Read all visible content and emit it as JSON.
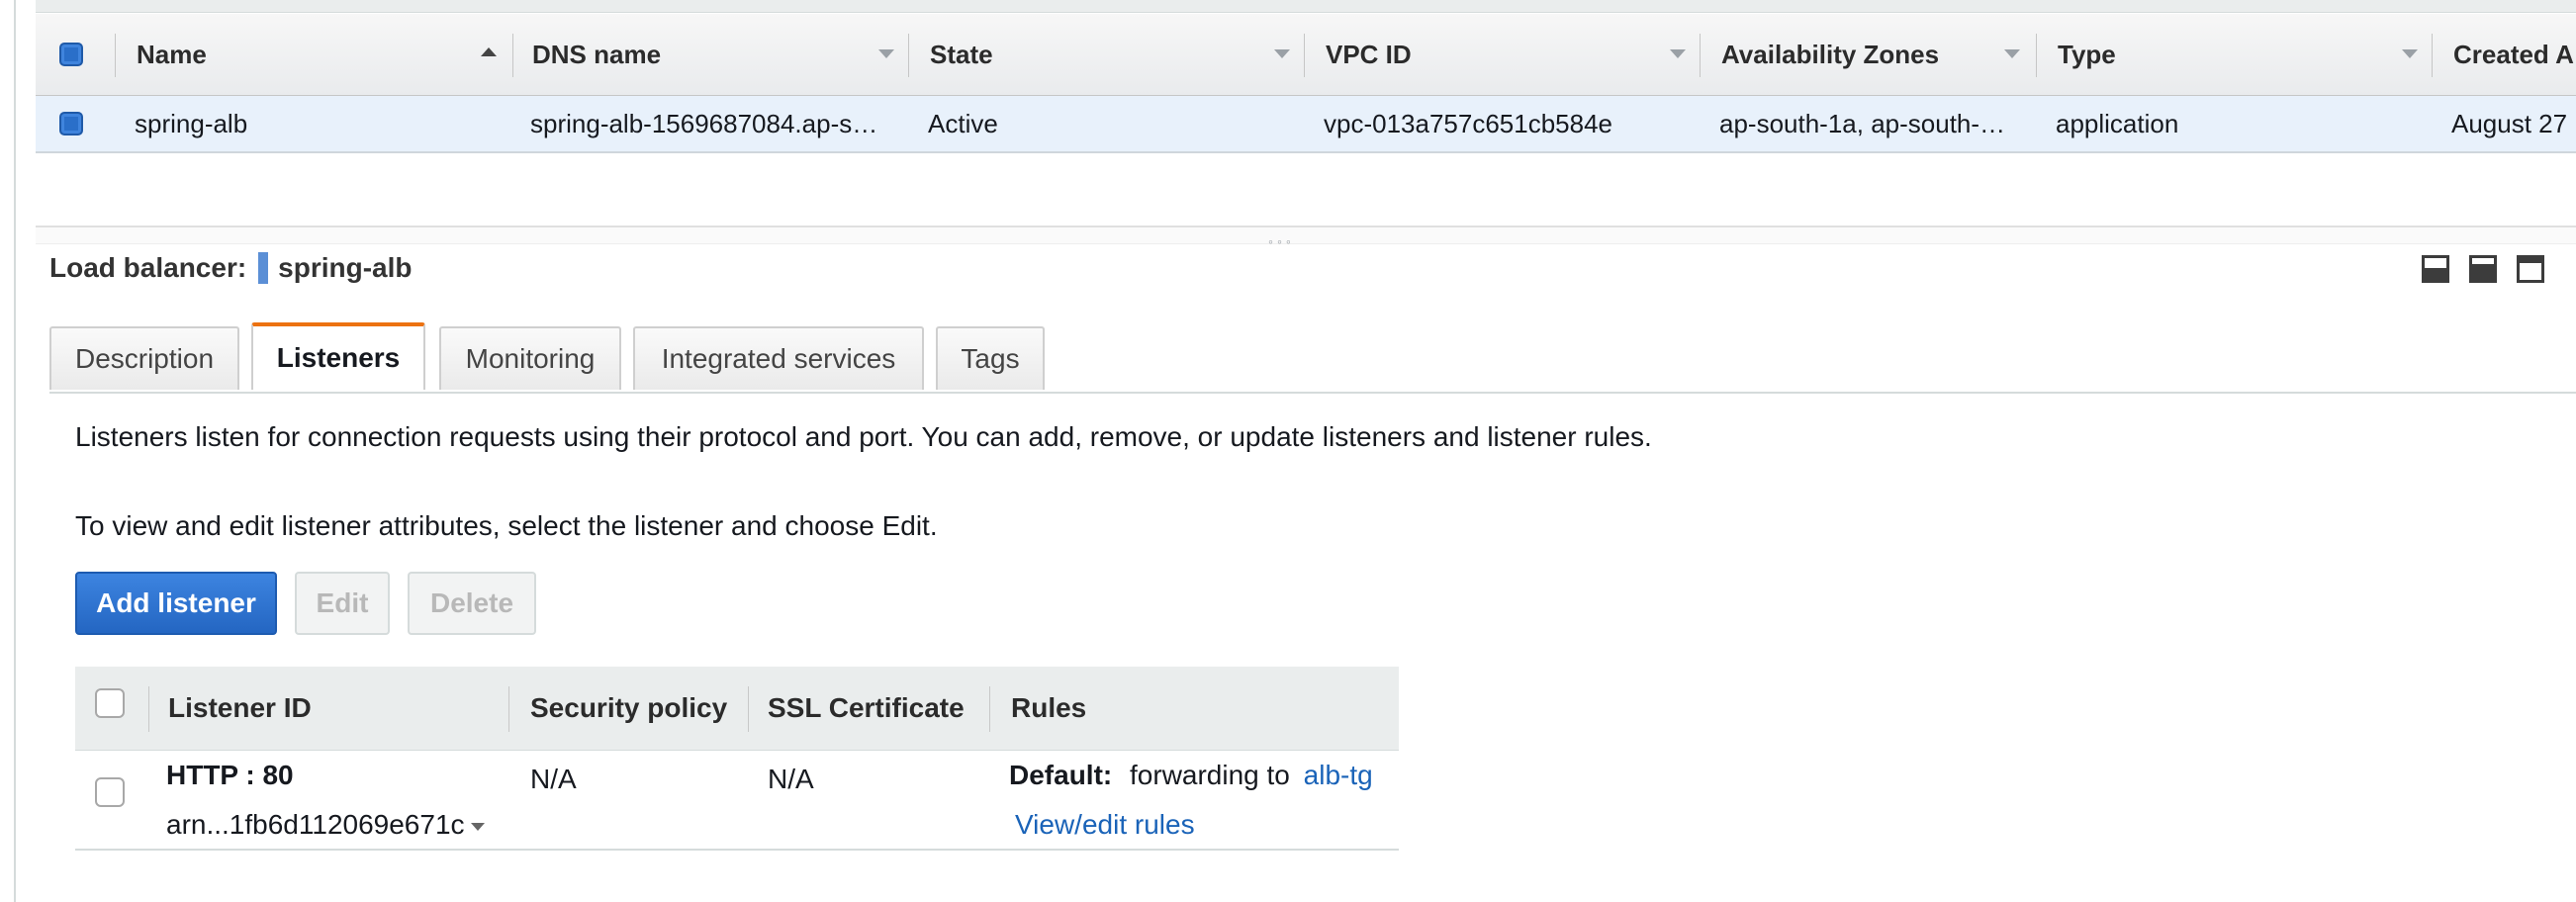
{
  "grid": {
    "columns": [
      {
        "label": "Name"
      },
      {
        "label": "DNS name"
      },
      {
        "label": "State"
      },
      {
        "label": "VPC ID"
      },
      {
        "label": "Availability Zones"
      },
      {
        "label": "Type"
      },
      {
        "label": "Created A"
      }
    ],
    "rows": [
      {
        "selected": true,
        "name": "spring-alb",
        "dns_name": "spring-alb-1569687084.ap-s…",
        "state": "Active",
        "vpc_id": "vpc-013a757c651cb584e",
        "availability_zones": "ap-south-1a, ap-south-…",
        "type": "application",
        "created": "August 27"
      }
    ]
  },
  "details": {
    "label": "Load balancer:",
    "name": "spring-alb",
    "tabs": [
      {
        "label": "Description",
        "active": false
      },
      {
        "label": "Listeners",
        "active": true
      },
      {
        "label": "Monitoring",
        "active": false
      },
      {
        "label": "Integrated services",
        "active": false
      },
      {
        "label": "Tags",
        "active": false
      }
    ]
  },
  "listeners": {
    "intro": "Listeners listen for connection requests using their protocol and port. You can add, remove, or update listeners and listener rules.",
    "instructions": "To view and edit listener attributes, select the listener and choose Edit.",
    "buttons": {
      "add": "Add listener",
      "edit": "Edit",
      "delete": "Delete"
    },
    "table": {
      "headers": {
        "listener_id": "Listener ID",
        "security_policy": "Security policy",
        "ssl_certificate": "SSL Certificate",
        "rules": "Rules"
      },
      "rows": [
        {
          "protocol_port": "HTTP : 80",
          "arn": "arn...1fb6d112069e671c",
          "security_policy": "N/A",
          "ssl_certificate": "N/A",
          "default_label": "Default:",
          "default_action": "forwarding to",
          "target_group": "alb-tg",
          "view_rules": "View/edit rules"
        }
      ]
    }
  },
  "colors": {
    "accent_orange": "#ec7211",
    "primary_blue": "#2466c2",
    "link_blue": "#1a63b8",
    "selected_row": "#e8f1fb"
  }
}
